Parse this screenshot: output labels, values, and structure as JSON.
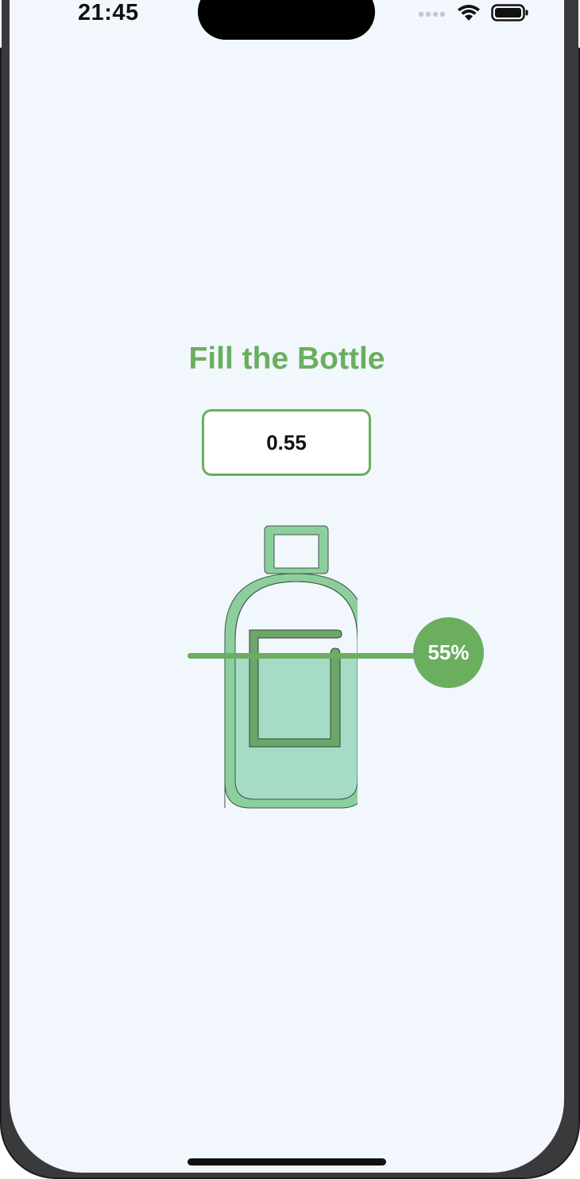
{
  "status_bar": {
    "time": "21:45",
    "icons": [
      "cellular-dots-icon",
      "wifi-icon",
      "battery-icon"
    ]
  },
  "app": {
    "title": "Fill the Bottle",
    "value_input": "0.55",
    "fill_fraction": 0.55,
    "slider_label": "55%"
  },
  "colors": {
    "accent": "#6aae5e",
    "bottle_outline": "#8ccf9d",
    "bottle_fill": "#a6dcc6",
    "label_square": "#6ea56a",
    "screen_background": "#f2f7fd"
  }
}
